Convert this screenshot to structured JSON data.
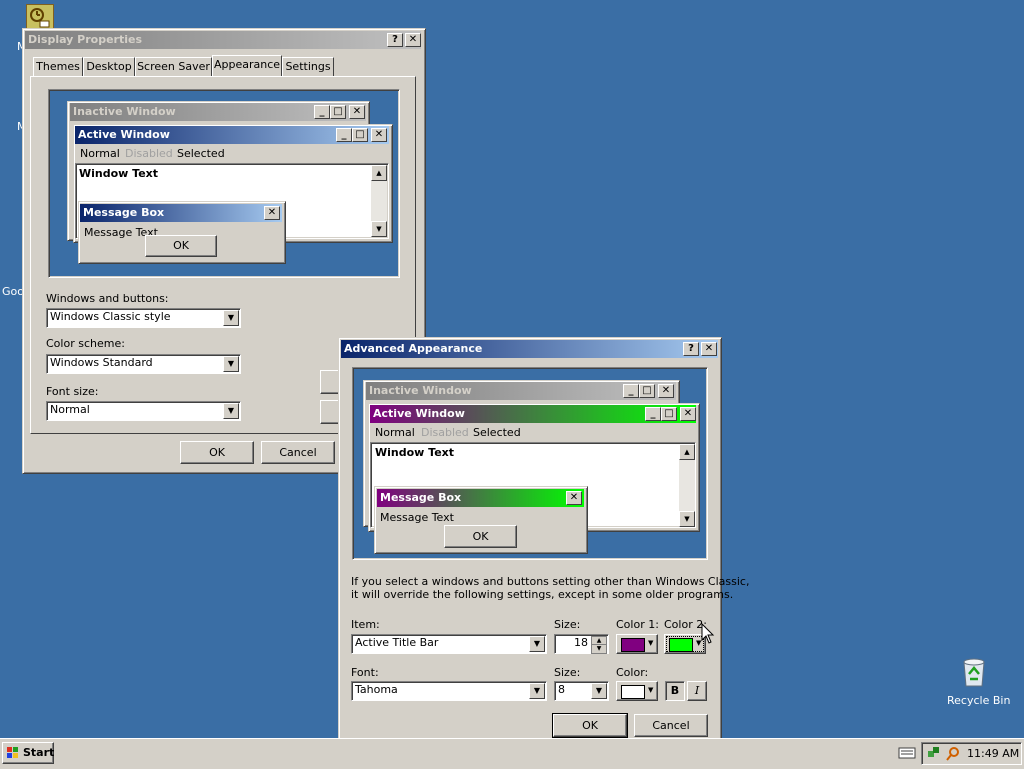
{
  "desktop": {
    "left_labels": [
      "M",
      "M",
      "Goo"
    ],
    "recycle_bin_label": "Recycle Bin"
  },
  "display_properties": {
    "title": "Display Properties",
    "tabs": [
      "Themes",
      "Desktop",
      "Screen Saver",
      "Appearance",
      "Settings"
    ],
    "active_tab": "Appearance",
    "preview": {
      "inactive_title": "Inactive Window",
      "active_title": "Active Window",
      "menu": {
        "normal": "Normal",
        "disabled": "Disabled",
        "selected": "Selected"
      },
      "window_text": "Window Text",
      "message_box_title": "Message Box",
      "message_text": "Message Text",
      "ok": "OK"
    },
    "windows_buttons_label": "Windows and buttons:",
    "windows_buttons_value": "Windows Classic style",
    "color_scheme_label": "Color scheme:",
    "color_scheme_value": "Windows Standard",
    "font_size_label": "Font size:",
    "font_size_value": "Normal",
    "ok": "OK",
    "cancel": "Cancel"
  },
  "advanced": {
    "title": "Advanced Appearance",
    "preview": {
      "inactive_title": "Inactive Window",
      "active_title": "Active Window",
      "menu": {
        "normal": "Normal",
        "disabled": "Disabled",
        "selected": "Selected"
      },
      "window_text": "Window Text",
      "message_box_title": "Message Box",
      "message_text": "Message Text",
      "ok": "OK"
    },
    "info_line1": "If you select a windows and buttons setting other than Windows Classic,",
    "info_line2": "it will override the following settings, except in some older programs.",
    "item_label": "Item:",
    "item_value": "Active Title Bar",
    "size_label": "Size:",
    "size_value": "18",
    "color1_label": "Color 1:",
    "color2_label": "Color 2:",
    "font_label": "Font:",
    "font_value": "Tahoma",
    "font_size_label": "Size:",
    "font_size_value": "8",
    "font_color_label": "Color:",
    "bold": "B",
    "italic": "I",
    "ok": "OK",
    "cancel": "Cancel",
    "colors": {
      "color1": "#800080",
      "color2": "#00ff00",
      "font_color": "#ffffff"
    }
  },
  "taskbar": {
    "start": "Start",
    "clock": "11:49 AM"
  }
}
